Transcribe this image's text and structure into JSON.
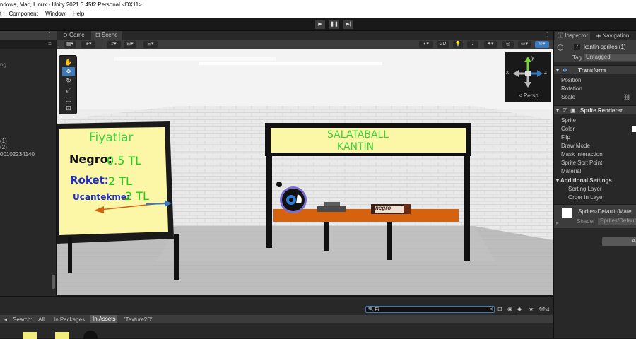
{
  "window": {
    "title": "ndows, Mac, Linux - Unity 2021.3.45f2 Personal <DX11>"
  },
  "menu": [
    "t",
    "Component",
    "Window",
    "Help"
  ],
  "hierarchy": {
    "lines": [
      "ng",
      "(1)",
      "(2)",
      "00102234140"
    ]
  },
  "tabs": {
    "game": "Game",
    "scene": "Scene"
  },
  "scene_toolbar": {
    "mode2d": "2D"
  },
  "gizmo": {
    "persp": "Persp",
    "y": "y",
    "x": "x",
    "z": "z"
  },
  "scene": {
    "board_title": "Fiyatlar",
    "prices": [
      {
        "name": "Negro:",
        "price": "0.5 TL"
      },
      {
        "name": "Roket:",
        "price": "2 TL"
      },
      {
        "name": "Ucantekme:",
        "price": "2 TL"
      }
    ],
    "sign_line1": "SALATABALL",
    "sign_line2": "KANTİN",
    "wrapper_text": "negro"
  },
  "inspector": {
    "tab_inspector": "Inspector",
    "tab_navigation": "Navigation",
    "object_name": "kantin-sprites (1)",
    "tag_label": "Tag",
    "tag_value": "Untagged",
    "transform": {
      "title": "Transform",
      "position": "Position",
      "rotation": "Rotation",
      "scale": "Scale"
    },
    "sprite_renderer": {
      "title": "Sprite Renderer",
      "sprite": "Sprite",
      "color": "Color",
      "flip": "Flip",
      "draw_mode": "Draw Mode",
      "mask_interaction": "Mask Interaction",
      "sprite_sort_point": "Sprite Sort Point",
      "material": "Material",
      "additional_settings": "Additional Settings",
      "sorting_layer": "Sorting Layer",
      "order_in_layer": "Order in Layer"
    },
    "material_name": "Sprites-Default (Mate",
    "shader_label": "Shader",
    "shader_value": "Sprites/Default",
    "add_button": "Ac"
  },
  "project": {
    "search_label": "Search:",
    "filters": [
      "All",
      "In Packages",
      "In Assets",
      "'Texture2D'"
    ],
    "search_value": "Fi",
    "count": "4"
  },
  "colors": {
    "accent": "#3a79bb",
    "board": "#fbf7a6",
    "title_green": "#3bd33b",
    "name_blue": "#1f2fc4",
    "price_green": "#16d316",
    "counter": "#d5620f"
  }
}
